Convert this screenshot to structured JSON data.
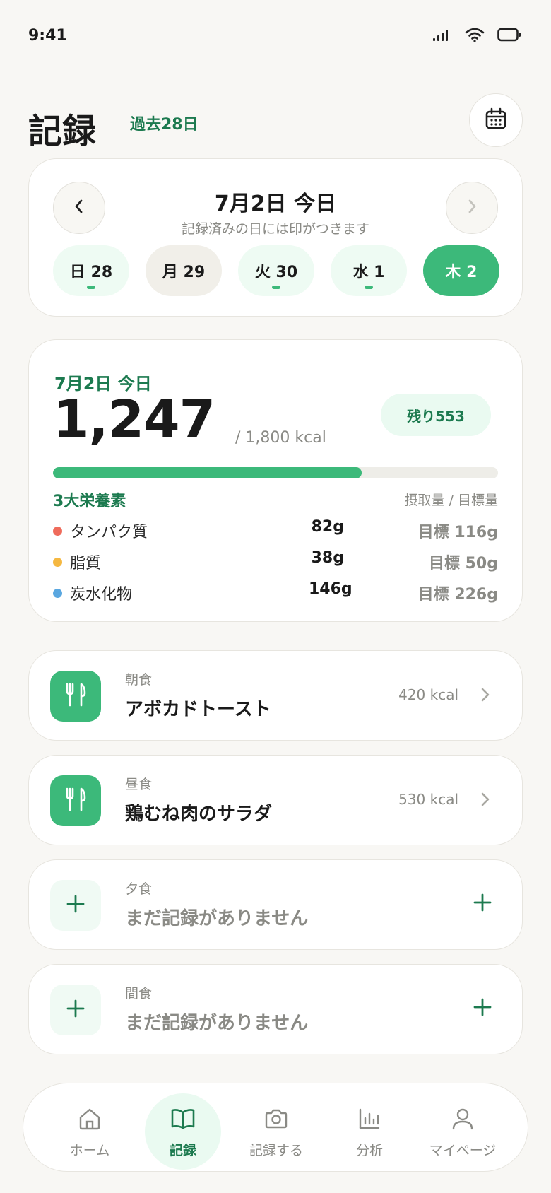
{
  "status_bar": {
    "time": "9:41"
  },
  "header": {
    "title": "記録",
    "subtitle": "過去28日"
  },
  "date_nav": {
    "title": "7月2日 今日",
    "note": "記録済みの日には印がつきます",
    "days": [
      {
        "label": "日 28",
        "logged": true,
        "active": false
      },
      {
        "label": "月 29",
        "logged": false,
        "active": false
      },
      {
        "label": "火 30",
        "logged": true,
        "active": false
      },
      {
        "label": "水 1",
        "logged": true,
        "active": false
      },
      {
        "label": "木 2",
        "logged": false,
        "active": true
      }
    ]
  },
  "summary": {
    "date": "7月2日 今日",
    "calories": "1,247",
    "goal": "/ 1,800 kcal",
    "remaining": "残り553",
    "progress": 0.693,
    "macro_title": "3大栄養素",
    "macro_col_header": "摂取量 / 目標量",
    "macros": [
      {
        "name": "タンパク質",
        "value": "82g",
        "target": "目標 116g",
        "color": "#ef6b5b"
      },
      {
        "name": "脂質",
        "value": "38g",
        "target": "目標 50g",
        "color": "#f5b841"
      },
      {
        "name": "炭水化物",
        "value": "146g",
        "target": "目標 226g",
        "color": "#5aa7e0"
      }
    ]
  },
  "meals": [
    {
      "label": "朝食",
      "name": "アボカドトースト",
      "kcal": "420 kcal",
      "logged": true
    },
    {
      "label": "昼食",
      "name": "鶏むね肉のサラダ",
      "kcal": "530 kcal",
      "logged": true
    },
    {
      "label": "夕食",
      "name": "まだ記録がありません",
      "kcal": "",
      "logged": false
    },
    {
      "label": "間食",
      "name": "まだ記録がありません",
      "kcal": "",
      "logged": false
    }
  ],
  "bottom_nav": [
    {
      "label": "ホーム",
      "icon": "home-icon",
      "active": false
    },
    {
      "label": "記録",
      "icon": "book-icon",
      "active": true
    },
    {
      "label": "記録する",
      "icon": "camera-icon",
      "active": false
    },
    {
      "label": "分析",
      "icon": "chart-icon",
      "active": false
    },
    {
      "label": "マイページ",
      "icon": "user-icon",
      "active": false
    }
  ],
  "colors": {
    "accent": "#3cb97a",
    "accent_dark": "#1c7a4f",
    "background": "#f8f7f4"
  }
}
